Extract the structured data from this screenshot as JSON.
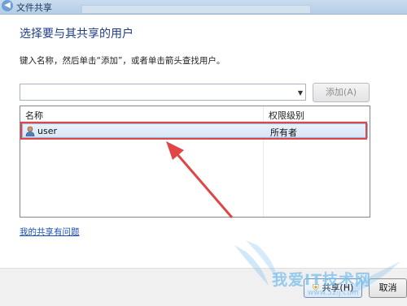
{
  "window": {
    "title": "文件共享"
  },
  "dialog": {
    "heading": "选择要与其共享的用户",
    "instruction": "键入名称，然后单击“添加”，或者单击箭头查找用户。",
    "combo_value": "",
    "add_label": "添加(A)",
    "columns": [
      "名称",
      "权限级别"
    ],
    "rows": [
      {
        "name": "user",
        "permission": "所有者"
      }
    ],
    "help_link": "我的共享有问题",
    "share_label": "共享(H)",
    "cancel_label": "取消"
  },
  "watermark": {
    "text": "我爱IT技术网",
    "url": "www.52ij.com"
  },
  "colors": {
    "annotation": "#e04646",
    "heading": "#1e3d8a",
    "link": "#1a4fb0"
  },
  "annotation": "red-arrow-pointing-to-user-row"
}
